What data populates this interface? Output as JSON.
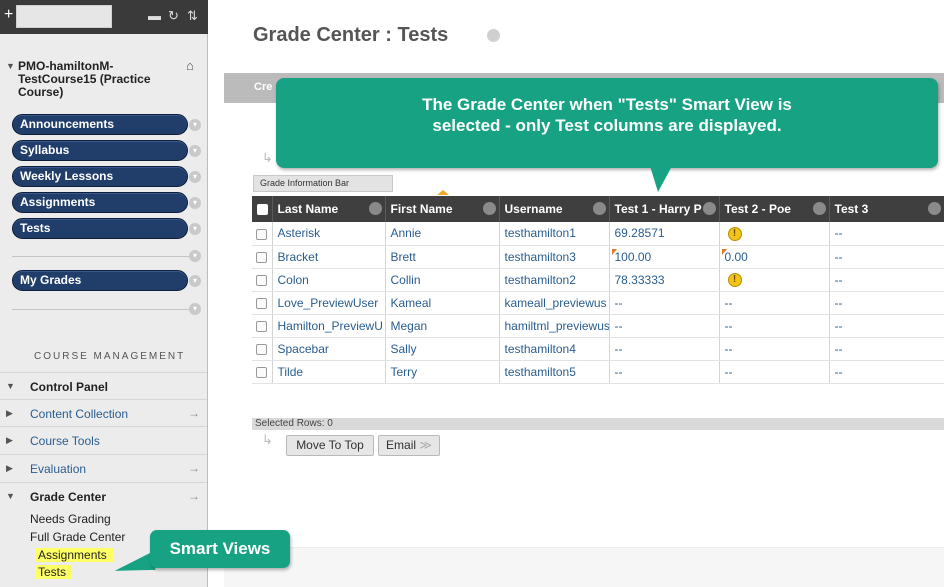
{
  "sidebar": {
    "course_title": "PMO-hamiltonM-TestCourse15 (Practice Course)",
    "menu": [
      {
        "label": "Announcements"
      },
      {
        "label": "Syllabus"
      },
      {
        "label": "Weekly Lessons"
      },
      {
        "label": "Assignments"
      },
      {
        "label": "Tests"
      }
    ],
    "my_grades": "My Grades",
    "course_management": "COURSE MANAGEMENT",
    "control_panel": "Control Panel",
    "cp_items": [
      {
        "label": "Content Collection"
      },
      {
        "label": "Course Tools"
      },
      {
        "label": "Evaluation"
      },
      {
        "label": "Grade Center"
      }
    ],
    "grade_center_links": {
      "needs_grading": "Needs Grading",
      "full_grade_center": "Full Grade Center",
      "assignments": "Assignments",
      "tests": "Tests"
    }
  },
  "main": {
    "page_title": "Grade Center : Tests",
    "create_label": "Cre",
    "grade_info_bar": "Grade Information Bar",
    "columns": [
      "Last Name",
      "First Name",
      "Username",
      "Test 1 - Harry P",
      "Test 2 - Poe",
      "Test 3"
    ],
    "rows": [
      {
        "last": "Asterisk",
        "first": "Annie",
        "username": "testhamilton1",
        "t1": "69.28571",
        "t2": "!",
        "t3": "--"
      },
      {
        "last": "Bracket",
        "first": "Brett",
        "username": "testhamilton3",
        "t1": "100.00",
        "t2": "0.00",
        "t3": "--"
      },
      {
        "last": "Colon",
        "first": "Collin",
        "username": "testhamilton2",
        "t1": "78.33333",
        "t2": "!",
        "t3": "--"
      },
      {
        "last": "Love_PreviewUser",
        "first": "Kameal",
        "username": "kameall_previewus",
        "t1": "--",
        "t2": "--",
        "t3": "--"
      },
      {
        "last": "Hamilton_PreviewU",
        "first": "Megan",
        "username": "hamiltml_previewus",
        "t1": "--",
        "t2": "--",
        "t3": "--"
      },
      {
        "last": "Spacebar",
        "first": "Sally",
        "username": "testhamilton4",
        "t1": "--",
        "t2": "--",
        "t3": "--"
      },
      {
        "last": "Tilde",
        "first": "Terry",
        "username": "testhamilton5",
        "t1": "--",
        "t2": "--",
        "t3": "--"
      }
    ],
    "selected_rows": "Selected Rows: 0",
    "move_to_top": "Move To Top",
    "email": "Email"
  },
  "callouts": {
    "main_line1": "The Grade Center when \"Tests\" Smart View is",
    "main_line2": "selected - only Test columns are displayed.",
    "smart_views": "Smart Views"
  },
  "colors": {
    "nav_button": "#213d6a",
    "callout": "#17a383",
    "highlight": "#ffff66"
  }
}
